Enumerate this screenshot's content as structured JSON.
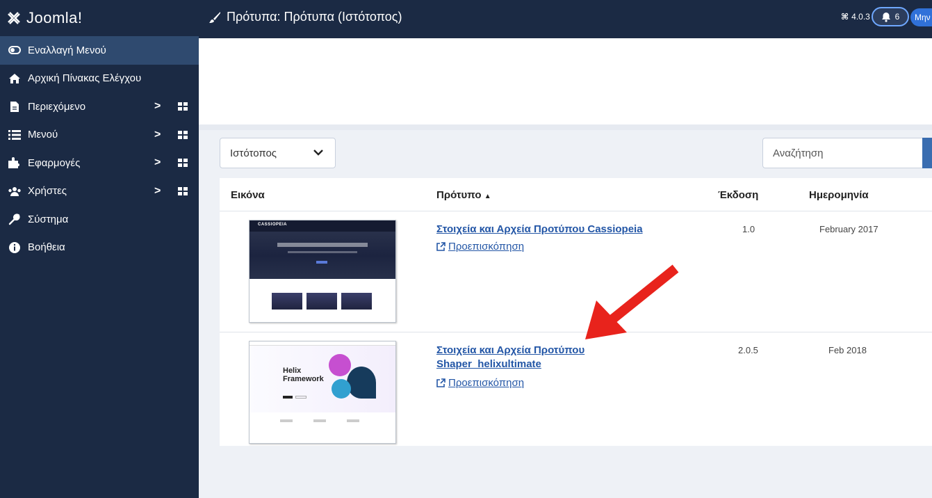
{
  "sidebar": {
    "logo": "Joomla!",
    "items": [
      {
        "label": "Εναλλαγή Μενού",
        "icon": "toggle-icon"
      },
      {
        "label": "Αρχική Πίνακας Ελέγχου",
        "icon": "home-icon"
      },
      {
        "label": "Περιεχόμενο",
        "icon": "file-icon"
      },
      {
        "label": "Μενού",
        "icon": "list-icon"
      },
      {
        "label": "Εφαρμογές",
        "icon": "puzzle-icon"
      },
      {
        "label": "Χρήστες",
        "icon": "users-icon"
      },
      {
        "label": "Σύστημα",
        "icon": "wrench-icon"
      },
      {
        "label": "Βοήθεια",
        "icon": "info-icon"
      }
    ]
  },
  "header": {
    "title": "Πρότυπα: Πρότυπα (Ιστότοπος)",
    "version": "4.0.3",
    "notifications": "6",
    "user_label": "Μην"
  },
  "filter": {
    "client": "Ιστότοπος",
    "search_placeholder": "Αναζήτηση"
  },
  "table": {
    "columns": [
      "Εικόνα",
      "Πρότυπο",
      "Έκδοση",
      "Ημερομηνία"
    ],
    "rows": [
      {
        "name": "Στοιχεία και Αρχεία Προτύπου Cassiopeia",
        "name_line2": "",
        "preview": "Προεπισκόπηση",
        "version": "1.0",
        "date": "February 2017",
        "thumb_brand": "CASSIOPEIA"
      },
      {
        "name": "Στοιχεία και Αρχεία Προτύπου",
        "name_line2": "Shaper_helixultimate",
        "preview": "Προεπισκόπηση",
        "version": "2.0.5",
        "date": "Feb 2018",
        "thumb_title": "Helix Framework"
      }
    ]
  },
  "colors": {
    "sidebar_bg": "#1b2a44",
    "active_item": "#2f4a6f",
    "link": "#2356a6",
    "arrow": "#e8231c"
  }
}
